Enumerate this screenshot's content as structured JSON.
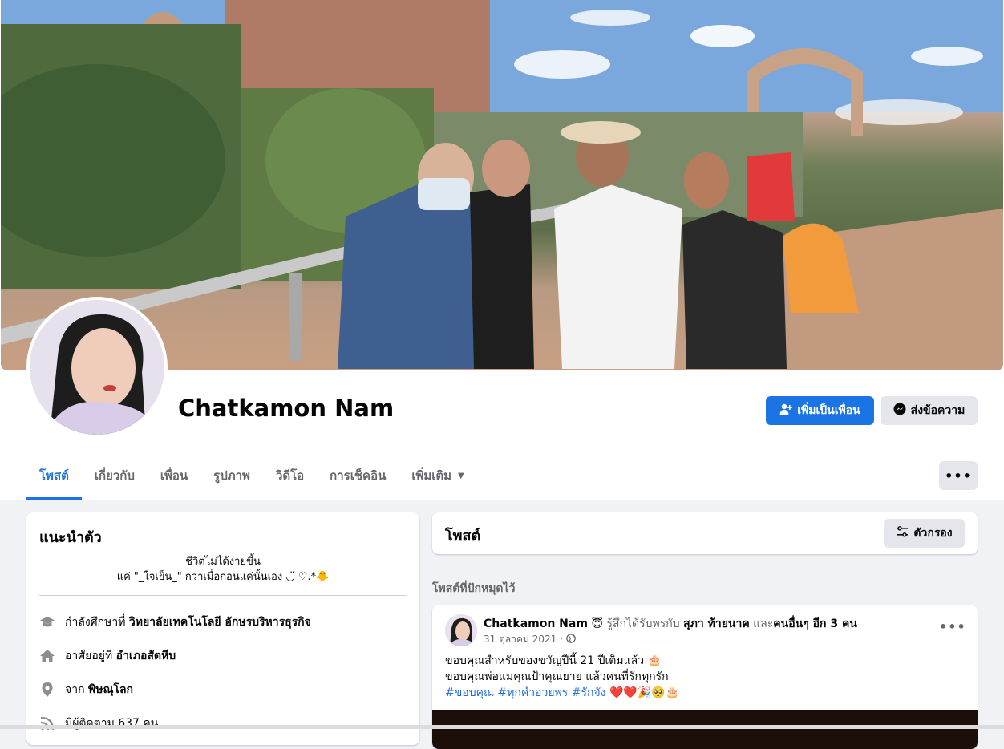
{
  "profile": {
    "name": "Chatkamon Nam",
    "add_friend_label": "เพิ่มเป็นเพื่อน",
    "message_label": "ส่งข้อความ"
  },
  "tabs": [
    {
      "label": "โพสต์"
    },
    {
      "label": "เกี่ยวกับ"
    },
    {
      "label": "เพื่อน"
    },
    {
      "label": "รูปภาพ"
    },
    {
      "label": "วิดีโอ"
    },
    {
      "label": "การเช็คอิน"
    },
    {
      "label": "เพิ่มเติม"
    }
  ],
  "more_button": "•••",
  "intro": {
    "title": "แนะนำตัว",
    "bio_line1": "ชีวิตไม่ได้ง่ายขึ้น",
    "bio_line2": "แค่ \"_ใจเย็น_\" กว่าเมื่อก่อนแค่นั้นเอง ◡̈ ♡.*🐥",
    "study_prefix": "กำลังศึกษาที่ ",
    "study_value": "วิทยาลัยเทคโนโลยี อักษรบริหารธุรกิจ",
    "lives_prefix": "อาศัยอยู่ที่ ",
    "lives_value": "อำเภอสัตหีบ",
    "from_prefix": "จาก ",
    "from_value": "พิษณุโลก",
    "followers_text": "มีผู้ติดตาม 637 คน"
  },
  "posts": {
    "title": "โพสต์",
    "filter_label": "ตัวกรอง",
    "pinned_label": "โพสต์ที่ปักหมุดไว้",
    "pinned_post": {
      "author": "Chatkamon Nam",
      "feeling_emoji": "😇",
      "feeling_text": " รู้สึกได้รับพรกับ ",
      "tagged": "สุภา ท้ายนาค",
      "and_text": " และ",
      "others": "คนอื่นๆ อีก 3 คน",
      "date": "31 ตุลาคม 2021 ·",
      "dots": "•••",
      "line1": "ขอบคุณสำหรับของขวัญปีนี้  21 ปีเต็มแล้ว 🎂",
      "line2": "ขอบคุณพ่อแม่คุณป้าคุณยาย แล้วคนที่รักทุกรัก",
      "hashtags": "#ขอบคุณ #ทุกคำอวยพร #รักจัง",
      "emojis": " ❤️❤️🎉🥺🎂"
    }
  },
  "colors": {
    "accent": "#1b74e4",
    "secondary_btn": "#e4e6eb",
    "background": "#f0f2f5",
    "muted_text": "#65676b"
  }
}
